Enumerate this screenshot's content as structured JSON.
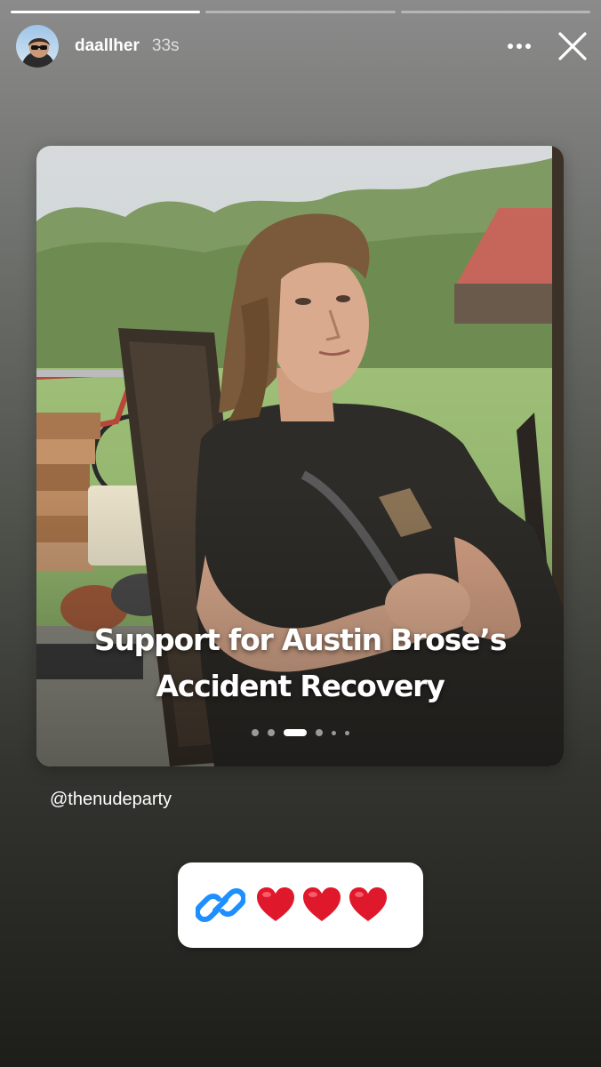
{
  "story": {
    "progress": [
      1,
      0,
      0
    ],
    "username": "daallher",
    "time": "33s",
    "avatar_icon": "user-avatar",
    "more_icon": "more-horizontal-icon",
    "close_icon": "close-icon"
  },
  "post": {
    "caption_line1": "Support for Austin Brose’s",
    "caption_line2": "Accident Recovery",
    "carousel_active_index": 2,
    "carousel_count": 6
  },
  "mention": "@thenudeparty",
  "link_sticker": {
    "icon": "link-icon",
    "text": "❤️❤️❤️",
    "heart_color": "#e0182b",
    "link_color": "#1e8fff"
  }
}
